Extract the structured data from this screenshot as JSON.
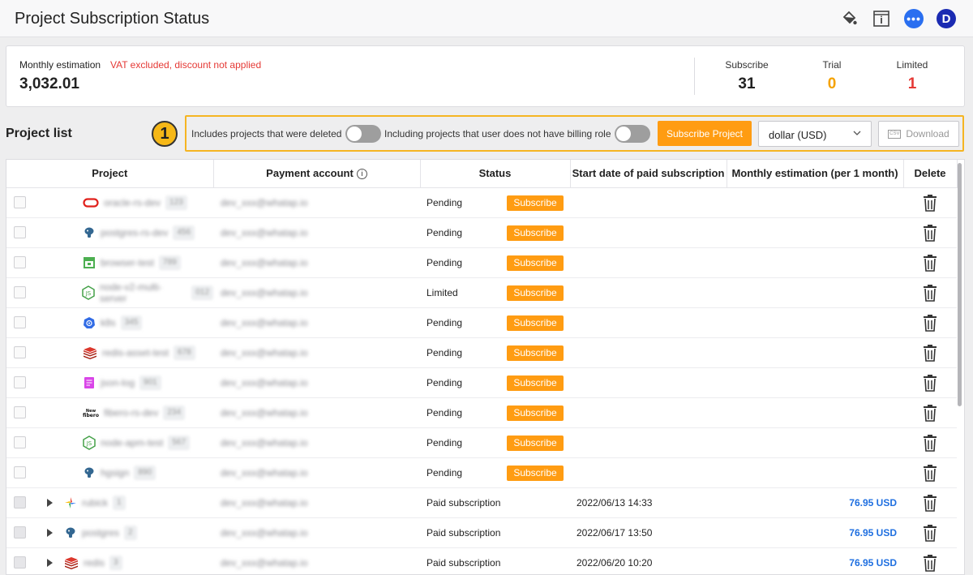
{
  "header": {
    "title": "Project Subscription Status",
    "icons": [
      "paint-bucket-icon",
      "info-panel-icon",
      "chat-icon",
      "avatar"
    ],
    "chat_glyph": "•••",
    "avatar_initial": "D"
  },
  "summary": {
    "estimation_label": "Monthly estimation",
    "estimation_note": "VAT excluded, discount not applied",
    "estimation_value": "3,032.01",
    "stats": [
      {
        "label": "Subscribe",
        "value": "31",
        "color": "#222222"
      },
      {
        "label": "Trial",
        "value": "0",
        "color": "#f5a200"
      },
      {
        "label": "Limited",
        "value": "1",
        "color": "#e53935"
      }
    ]
  },
  "project_list": {
    "title": "Project list",
    "step_badge": "1",
    "filters": {
      "deleted_label": "Includes projects that were deleted",
      "deleted_on": false,
      "billing_label": "Including projects that user does not have billing role",
      "billing_on": false
    },
    "subscribe_project_label": "Subscribe Project",
    "currency": "dollar (USD)",
    "download_label": "Download",
    "csv_glyph": "CSV"
  },
  "table": {
    "columns": [
      "Project",
      "Payment account",
      "Status",
      "Start date of paid subscription",
      "Monthly estimation (per 1 month)",
      "Delete"
    ],
    "subscribe_label": "Subscribe",
    "rows": [
      {
        "icon": "oracle-icon",
        "name": "oracle-rs-dev",
        "chip": "123",
        "account": "dev_xxx@whatap.io",
        "status": "Pending",
        "subscribe": true,
        "start": "",
        "amount": "",
        "expandable": false
      },
      {
        "icon": "postgresql-icon",
        "name": "postgres-rs-dev",
        "chip": "456",
        "account": "dev_xxx@whatap.io",
        "status": "Pending",
        "subscribe": true,
        "start": "",
        "amount": "",
        "expandable": false
      },
      {
        "icon": "browser-icon",
        "name": "browser-test",
        "chip": "789",
        "account": "dev_xxx@whatap.io",
        "status": "Pending",
        "subscribe": true,
        "start": "",
        "amount": "",
        "expandable": false
      },
      {
        "icon": "nodejs-icon",
        "name": "node-v2-multi-server",
        "chip": "012",
        "account": "dev_xxx@whatap.io",
        "status": "Limited",
        "subscribe": true,
        "start": "",
        "amount": "",
        "expandable": false
      },
      {
        "icon": "kubernetes-icon",
        "name": "k8s",
        "chip": "345",
        "account": "dev_xxx@whatap.io",
        "status": "Pending",
        "subscribe": true,
        "start": "",
        "amount": "",
        "expandable": false
      },
      {
        "icon": "redis-icon",
        "name": "redis-asset-test",
        "chip": "678",
        "account": "dev_xxx@whatap.io",
        "status": "Pending",
        "subscribe": true,
        "start": "",
        "amount": "",
        "expandable": false
      },
      {
        "icon": "log-icon",
        "name": "json-log",
        "chip": "901",
        "account": "dev_xxx@whatap.io",
        "status": "Pending",
        "subscribe": true,
        "start": "",
        "amount": "",
        "expandable": false
      },
      {
        "icon": "fibero-icon",
        "name": "fibero-rs-dev",
        "chip": "234",
        "account": "dev_xxx@whatap.io",
        "status": "Pending",
        "subscribe": true,
        "start": "",
        "amount": "",
        "expandable": false
      },
      {
        "icon": "nodejs-icon",
        "name": "node-apm-test",
        "chip": "567",
        "account": "dev_xxx@whatap.io",
        "status": "Pending",
        "subscribe": true,
        "start": "",
        "amount": "",
        "expandable": false
      },
      {
        "icon": "postgresql-icon",
        "name": "hgsign",
        "chip": "890",
        "account": "dev_xxx@whatap.io",
        "status": "Pending",
        "subscribe": true,
        "start": "",
        "amount": "",
        "expandable": false
      },
      {
        "icon": "gcp-icon",
        "name": "rubick",
        "chip": "1",
        "account": "dev_xxx@whatap.io",
        "status": "Paid subscription",
        "subscribe": false,
        "start": "2022/06/13 14:33",
        "amount": "76.95 USD",
        "expandable": true
      },
      {
        "icon": "postgresql-icon",
        "name": "postgres",
        "chip": "2",
        "account": "dev_xxx@whatap.io",
        "status": "Paid subscription",
        "subscribe": false,
        "start": "2022/06/17 13:50",
        "amount": "76.95 USD",
        "expandable": true
      },
      {
        "icon": "redis-icon",
        "name": "redis",
        "chip": "3",
        "account": "dev_xxx@whatap.io",
        "status": "Paid subscription",
        "subscribe": false,
        "start": "2022/06/20 10:20",
        "amount": "76.95 USD",
        "expandable": true
      }
    ]
  }
}
